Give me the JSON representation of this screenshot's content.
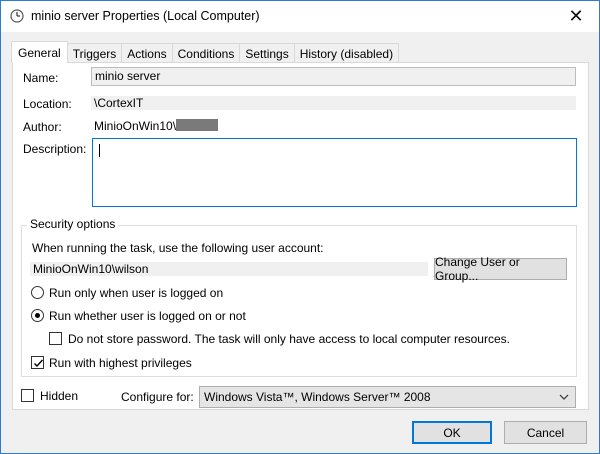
{
  "window": {
    "title": "minio server Properties (Local Computer)",
    "icon": "clock-task-icon",
    "close_glyph": "✕"
  },
  "tabs": [
    "General",
    "Triggers",
    "Actions",
    "Conditions",
    "Settings",
    "History (disabled)"
  ],
  "general": {
    "name_label": "Name:",
    "name_value": "minio server",
    "location_label": "Location:",
    "location_value": "\\CortexIT",
    "author_label": "Author:",
    "author_value": "MinioOnWin10\\",
    "description_label": "Description:",
    "description_value": ""
  },
  "security": {
    "title": "Security options",
    "account_prompt": "When running the task, use the following user account:",
    "account_value": "MinioOnWin10\\wilson",
    "change_button": "Change User or Group...",
    "radio_logged_on": "Run only when user is logged on",
    "radio_whether": "Run whether user is logged on or not",
    "do_not_store": "Do not store password.  The task will only have access to local computer resources.",
    "highest_priv": "Run with highest privileges",
    "selected_radio": "whether",
    "do_not_store_checked": false,
    "highest_priv_checked": true
  },
  "bottom": {
    "hidden_label": "Hidden",
    "hidden_checked": false,
    "configure_label": "Configure for:",
    "configure_value": "Windows Vista™, Windows Server™ 2008",
    "ok": "OK",
    "cancel": "Cancel"
  },
  "colors": {
    "accent": "#0078d7",
    "window_border": "#2f7bd4"
  }
}
